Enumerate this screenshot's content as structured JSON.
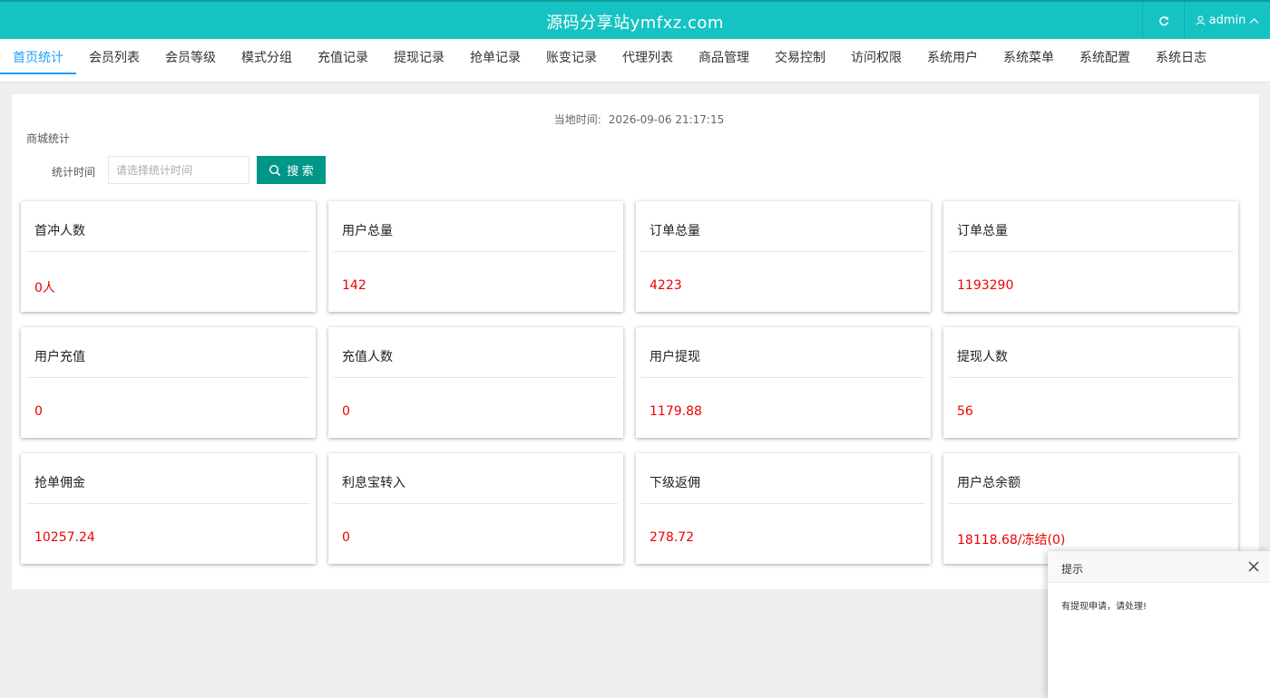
{
  "header": {
    "brand": "源码分享站ymfxz.com",
    "user": "admin"
  },
  "nav": {
    "items": [
      {
        "label": "首页统计",
        "active": true
      },
      {
        "label": "会员列表"
      },
      {
        "label": "会员等级"
      },
      {
        "label": "模式分组"
      },
      {
        "label": "充值记录"
      },
      {
        "label": "提现记录"
      },
      {
        "label": "抢单记录"
      },
      {
        "label": "账变记录"
      },
      {
        "label": "代理列表"
      },
      {
        "label": "商品管理"
      },
      {
        "label": "交易控制"
      },
      {
        "label": "访问权限"
      },
      {
        "label": "系统用户"
      },
      {
        "label": "系统菜单"
      },
      {
        "label": "系统配置"
      },
      {
        "label": "系统日志"
      }
    ]
  },
  "main": {
    "local_time_label": "当地时间:",
    "local_time_value": "2026-09-06 21:17:15",
    "section_title": "商城统计",
    "filter": {
      "label": "统计时间",
      "placeholder": "请选择统计时间",
      "search_label": "搜 索"
    },
    "cards": [
      {
        "title": "首冲人数",
        "value": "0人"
      },
      {
        "title": "用户总量",
        "value": "142"
      },
      {
        "title": "订单总量",
        "value": "4223"
      },
      {
        "title": "订单总量",
        "value": "1193290"
      },
      {
        "title": "用户充值",
        "value": "0"
      },
      {
        "title": "充值人数",
        "value": "0"
      },
      {
        "title": "用户提现",
        "value": "1179.88"
      },
      {
        "title": "提现人数",
        "value": "56"
      },
      {
        "title": "抢单佣金",
        "value": "10257.24"
      },
      {
        "title": "利息宝转入",
        "value": "0"
      },
      {
        "title": "下级返佣",
        "value": "278.72"
      },
      {
        "title": "用户总余额",
        "value": "18118.68/冻结(0)"
      }
    ]
  },
  "toast": {
    "title": "提示",
    "message": "有提现申请，请处理!"
  },
  "colors": {
    "header_bg": "#16c3c3",
    "nav_active": "#1e9fff",
    "button_bg": "#009688",
    "value_red": "#e00000"
  },
  "icons": {
    "refresh": "refresh-icon",
    "user": "user-icon",
    "chevron": "chevron-up-icon",
    "search": "search-icon",
    "close": "close-icon"
  }
}
